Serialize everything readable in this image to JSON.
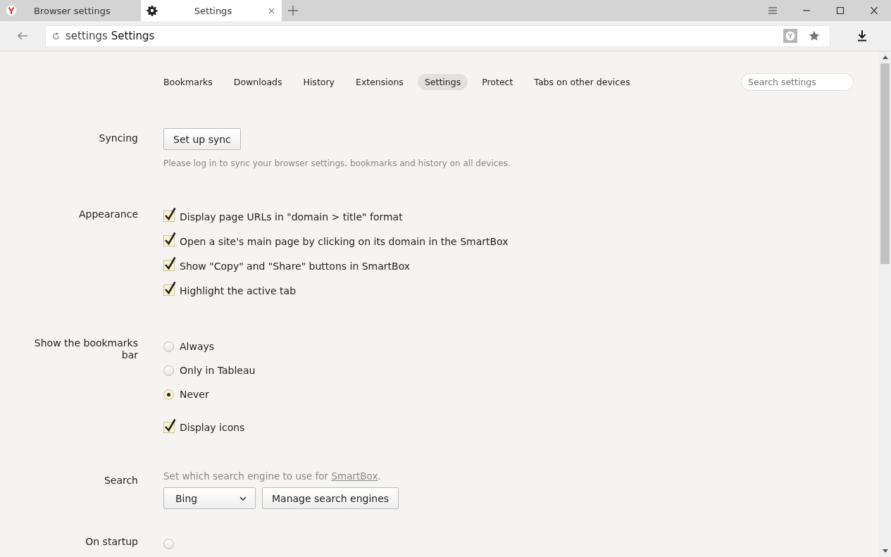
{
  "tabs": [
    {
      "title": "Browser settings",
      "selected": false
    },
    {
      "title": "Settings",
      "selected": true
    }
  ],
  "address": {
    "host": "settings",
    "title": "Settings"
  },
  "nav": [
    {
      "label": "Bookmarks",
      "selected": false
    },
    {
      "label": "Downloads",
      "selected": false
    },
    {
      "label": "History",
      "selected": false
    },
    {
      "label": "Extensions",
      "selected": false
    },
    {
      "label": "Settings",
      "selected": true
    },
    {
      "label": "Protect",
      "selected": false
    },
    {
      "label": "Tabs on other devices",
      "selected": false
    }
  ],
  "search": {
    "placeholder": "Search settings"
  },
  "sections": [
    {
      "label": "Syncing",
      "items": [
        {
          "kind": "button",
          "label": "Set up sync"
        },
        {
          "kind": "note",
          "text": "Please log in to sync your browser settings, bookmarks and history on all devices."
        }
      ]
    },
    {
      "label": "Appearance",
      "items": [
        {
          "kind": "checkbox",
          "label": "Display page URLs in \"domain > title\" format",
          "checked": true
        },
        {
          "kind": "checkbox",
          "label": "Open a site's main page by clicking on its domain in the SmartBox",
          "checked": true
        },
        {
          "kind": "checkbox",
          "label": "Show \"Copy\" and \"Share\" buttons in SmartBox",
          "checked": true
        },
        {
          "kind": "checkbox",
          "label": "Highlight the active tab",
          "checked": true
        }
      ]
    },
    {
      "label": "Show the bookmarks bar",
      "items": [
        {
          "kind": "radio",
          "label": "Always",
          "selected": false
        },
        {
          "kind": "radio",
          "label": "Only in Tableau",
          "selected": false
        },
        {
          "kind": "radio",
          "label": "Never",
          "selected": true
        },
        {
          "kind": "checkbox",
          "label": "Display icons",
          "checked": true
        }
      ]
    },
    {
      "label": "Search",
      "items": [
        {
          "kind": "linknote",
          "text": "Set which search engine to use for ",
          "link": "SmartBox",
          "after": "."
        },
        {
          "kind": "select",
          "value": "Bing",
          "button": "Manage search engines"
        }
      ]
    },
    {
      "label": "On startup",
      "items": [
        {
          "kind": "radio",
          "selected": false
        }
      ]
    }
  ]
}
